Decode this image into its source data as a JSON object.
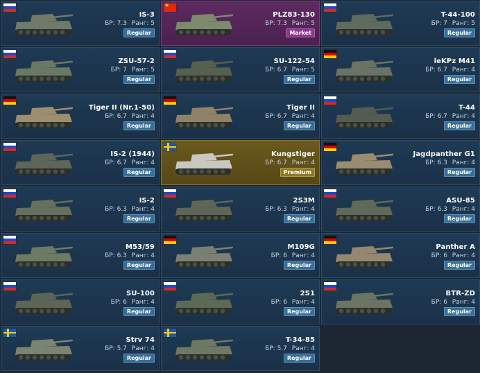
{
  "vehicles": [
    {
      "name": "IS-3",
      "nation": "ru",
      "br_label": "БР:",
      "br": "7.3",
      "rank_label": "Ранг:",
      "rank": "5",
      "type": "Regular",
      "tone": "#6f7a6a"
    },
    {
      "name": "PLZ83-130",
      "nation": "cn",
      "br_label": "БР:",
      "br": "7.3",
      "rank_label": "Ранг:",
      "rank": "5",
      "type": "Market",
      "tone": "#7d8a6e"
    },
    {
      "name": "T-44-100",
      "nation": "ru",
      "br_label": "БР:",
      "br": "7",
      "rank_label": "Ранг:",
      "rank": "5",
      "type": "Regular",
      "tone": "#5f6b5c"
    },
    {
      "name": "ZSU-57-2",
      "nation": "ru",
      "br_label": "БР:",
      "br": "7",
      "rank_label": "Ранг:",
      "rank": "5",
      "type": "Regular",
      "tone": "#6b7866"
    },
    {
      "name": "SU-122-54",
      "nation": "ru",
      "br_label": "БР:",
      "br": "6.7",
      "rank_label": "Ранг:",
      "rank": "5",
      "type": "Regular",
      "tone": "#55604f"
    },
    {
      "name": "leKPz M41",
      "nation": "de",
      "br_label": "БР:",
      "br": "6.7",
      "rank_label": "Ранг:",
      "rank": "4",
      "type": "Regular",
      "tone": "#6b7366"
    },
    {
      "name": "Tiger II (Nr.1-50)",
      "nation": "de",
      "br_label": "БР:",
      "br": "6.7",
      "rank_label": "Ранг:",
      "rank": "4",
      "type": "Regular",
      "tone": "#9c8e6e"
    },
    {
      "name": "Tiger II",
      "nation": "de",
      "br_label": "БР:",
      "br": "6.7",
      "rank_label": "Ранг:",
      "rank": "4",
      "type": "Regular",
      "tone": "#8f8268"
    },
    {
      "name": "T-44",
      "nation": "ru",
      "br_label": "БР:",
      "br": "6.7",
      "rank_label": "Ранг:",
      "rank": "4",
      "type": "Regular",
      "tone": "#545c52"
    },
    {
      "name": "IS-2 (1944)",
      "nation": "ru",
      "br_label": "БР:",
      "br": "6.7",
      "rank_label": "Ранг:",
      "rank": "4",
      "type": "Regular",
      "tone": "#5d6659"
    },
    {
      "name": "Kungstiger",
      "nation": "se",
      "br_label": "БР:",
      "br": "6.7",
      "rank_label": "Ранг:",
      "rank": "4",
      "type": "Premium",
      "tone": "#c8c8c0"
    },
    {
      "name": "Jagdpanther G1",
      "nation": "de",
      "br_label": "БР:",
      "br": "6.3",
      "rank_label": "Ранг:",
      "rank": "4",
      "type": "Regular",
      "tone": "#9a8c70"
    },
    {
      "name": "IS-2",
      "nation": "ru",
      "br_label": "БР:",
      "br": "6.3",
      "rank_label": "Ранг:",
      "rank": "4",
      "type": "Regular",
      "tone": "#66705f"
    },
    {
      "name": "2S3M",
      "nation": "ru",
      "br_label": "БР:",
      "br": "6.3",
      "rank_label": "Ранг:",
      "rank": "4",
      "type": "Regular",
      "tone": "#5d6657"
    },
    {
      "name": "ASU-85",
      "nation": "ru",
      "br_label": "БР:",
      "br": "6.3",
      "rank_label": "Ранг:",
      "rank": "4",
      "type": "Regular",
      "tone": "#606a5a"
    },
    {
      "name": "M53/59",
      "nation": "ru",
      "br_label": "БР:",
      "br": "6.3",
      "rank_label": "Ранг:",
      "rank": "4",
      "type": "Regular",
      "tone": "#6f7a64"
    },
    {
      "name": "M109G",
      "nation": "de",
      "br_label": "БР:",
      "br": "6",
      "rank_label": "Ранг:",
      "rank": "4",
      "type": "Regular",
      "tone": "#7c8074"
    },
    {
      "name": "Panther A",
      "nation": "de",
      "br_label": "БР:",
      "br": "6",
      "rank_label": "Ранг:",
      "rank": "4",
      "type": "Regular",
      "tone": "#958870"
    },
    {
      "name": "SU-100",
      "nation": "ru",
      "br_label": "БР:",
      "br": "6",
      "rank_label": "Ранг:",
      "rank": "4",
      "type": "Regular",
      "tone": "#5d6557"
    },
    {
      "name": "2S1",
      "nation": "ru",
      "br_label": "БР:",
      "br": "6",
      "rank_label": "Ранг:",
      "rank": "4",
      "type": "Regular",
      "tone": "#5c6a55"
    },
    {
      "name": "BTR-ZD",
      "nation": "ru",
      "br_label": "БР:",
      "br": "6",
      "rank_label": "Ранг:",
      "rank": "4",
      "type": "Regular",
      "tone": "#6c7466"
    },
    {
      "name": "Strv 74",
      "nation": "se",
      "br_label": "БР:",
      "br": "5.7",
      "rank_label": "Ранг:",
      "rank": "4",
      "type": "Regular",
      "tone": "#7a8470"
    },
    {
      "name": "T-34-85",
      "nation": "se",
      "br_label": "БР:",
      "br": "5.7",
      "rank_label": "Ранг:",
      "rank": "4",
      "type": "Regular",
      "tone": "#6e7964"
    }
  ]
}
